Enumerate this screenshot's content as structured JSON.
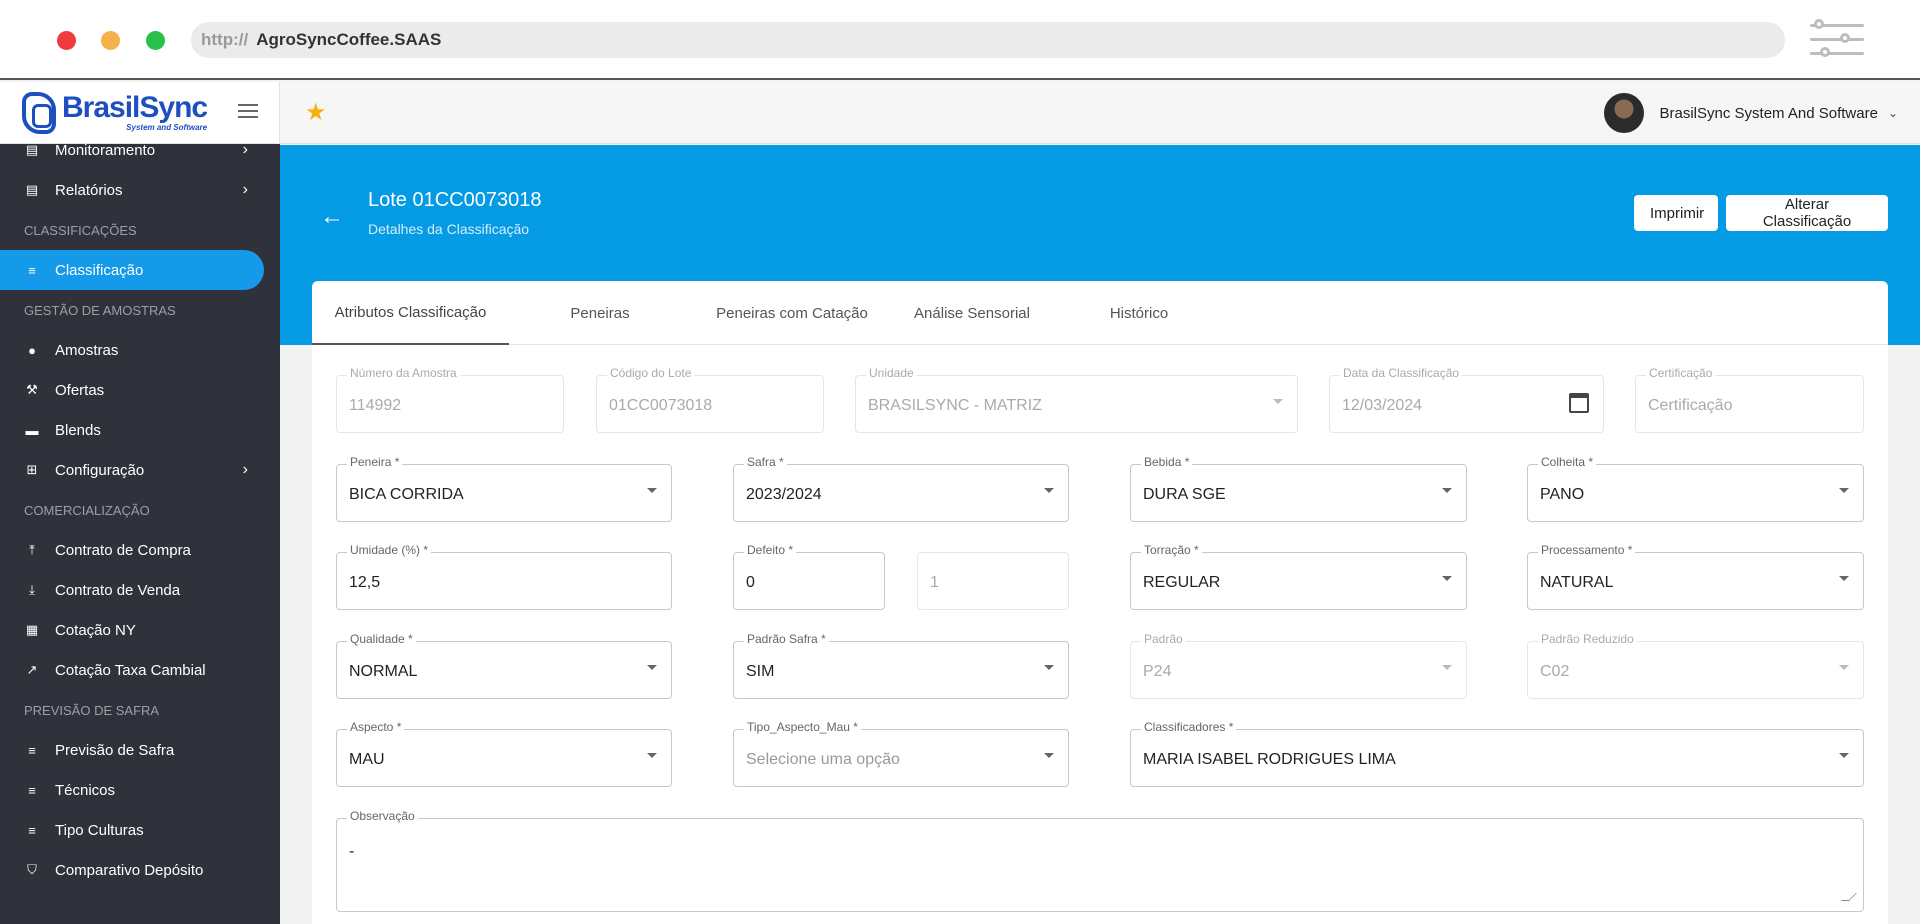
{
  "browser": {
    "url_proto": "http://",
    "url_host": "AgroSyncCoffee.SAAS"
  },
  "brand": {
    "name": "BrasilSync",
    "tagline": "System and Software"
  },
  "sidebar": {
    "items": [
      {
        "type": "item",
        "label": "Monitoramento",
        "icon": "clipboard-icon",
        "chevron": true
      },
      {
        "type": "item",
        "label": "Relatórios",
        "icon": "clipboard-icon",
        "chevron": true
      },
      {
        "type": "header",
        "label": "CLASSIFICAÇÕES"
      },
      {
        "type": "item",
        "label": "Classificação",
        "icon": "list-icon",
        "active": true
      },
      {
        "type": "header",
        "label": "GESTÃO DE AMOSTRAS"
      },
      {
        "type": "item",
        "label": "Amostras",
        "icon": "info-icon"
      },
      {
        "type": "item",
        "label": "Ofertas",
        "icon": "gavel-icon"
      },
      {
        "type": "item",
        "label": "Blends",
        "icon": "coffee-icon"
      },
      {
        "type": "item",
        "label": "Configuração",
        "icon": "plus-box-icon",
        "chevron": true
      },
      {
        "type": "header",
        "label": "COMERCIALIZAÇÃO"
      },
      {
        "type": "item",
        "label": "Contrato de Compra",
        "icon": "upload-icon"
      },
      {
        "type": "item",
        "label": "Contrato de Venda",
        "icon": "download-icon"
      },
      {
        "type": "item",
        "label": "Cotação NY",
        "icon": "table-icon"
      },
      {
        "type": "item",
        "label": "Cotação Taxa Cambial",
        "icon": "trending-icon"
      },
      {
        "type": "header",
        "label": "PREVISÃO DE SAFRA"
      },
      {
        "type": "item",
        "label": "Previsão de Safra",
        "icon": "list-icon"
      },
      {
        "type": "item",
        "label": "Técnicos",
        "icon": "list-icon"
      },
      {
        "type": "item",
        "label": "Tipo Culturas",
        "icon": "list-icon"
      },
      {
        "type": "item",
        "label": "Comparativo Depósito",
        "icon": "shield-check-icon"
      }
    ]
  },
  "header": {
    "user_name": "BrasilSync System And Software"
  },
  "hero": {
    "title": "Lote 01CC0073018",
    "subtitle": "Detalhes da Classificação",
    "print_label": "Imprimir",
    "alter_label": "Alterar Classificação"
  },
  "tabs": [
    {
      "label": "Atributos Classificação",
      "active": true
    },
    {
      "label": "Peneiras"
    },
    {
      "label": "Peneiras com Catação"
    },
    {
      "label": "Análise Sensorial"
    },
    {
      "label": "Histórico"
    }
  ],
  "form": {
    "numero_amostra": {
      "label": "Número da Amostra",
      "value": "114992"
    },
    "codigo_lote": {
      "label": "Código do Lote",
      "value": "01CC0073018"
    },
    "unidade": {
      "label": "Unidade",
      "value": "BRASILSYNC - MATRIZ"
    },
    "data_classificacao": {
      "label": "Data da Classificação",
      "value": "12/03/2024"
    },
    "certificacao": {
      "label": "Certificação",
      "placeholder": "Certificação"
    },
    "peneira": {
      "label": "Peneira *",
      "value": "BICA CORRIDA"
    },
    "safra": {
      "label": "Safra *",
      "value": "2023/2024"
    },
    "bebida": {
      "label": "Bebida *",
      "value": "DURA SGE"
    },
    "colheita": {
      "label": "Colheita *",
      "value": "PANO"
    },
    "umidade": {
      "label": "Umidade (%) *",
      "value": "12,5"
    },
    "defeito": {
      "label": "Defeito *",
      "value": "0"
    },
    "defeito_extra": {
      "value": "1"
    },
    "torracao": {
      "label": "Torração *",
      "value": "REGULAR"
    },
    "processamento": {
      "label": "Processamento *",
      "value": "NATURAL"
    },
    "qualidade": {
      "label": "Qualidade *",
      "value": "NORMAL"
    },
    "padrao_safra": {
      "label": "Padrão Safra *",
      "value": "SIM"
    },
    "padrao": {
      "label": "Padrão",
      "value": "P24"
    },
    "padrao_reduzido": {
      "label": "Padrão Reduzido",
      "value": "C02"
    },
    "aspecto": {
      "label": "Aspecto *",
      "value": "MAU"
    },
    "tipo_aspecto_mau": {
      "label": "Tipo_Aspecto_Mau *",
      "placeholder": "Selecione uma opção"
    },
    "classificadores": {
      "label": "Classificadores *",
      "value": "MARIA ISABEL RODRIGUES LIMA"
    },
    "observacao": {
      "label": "Observação",
      "value": "-"
    }
  }
}
